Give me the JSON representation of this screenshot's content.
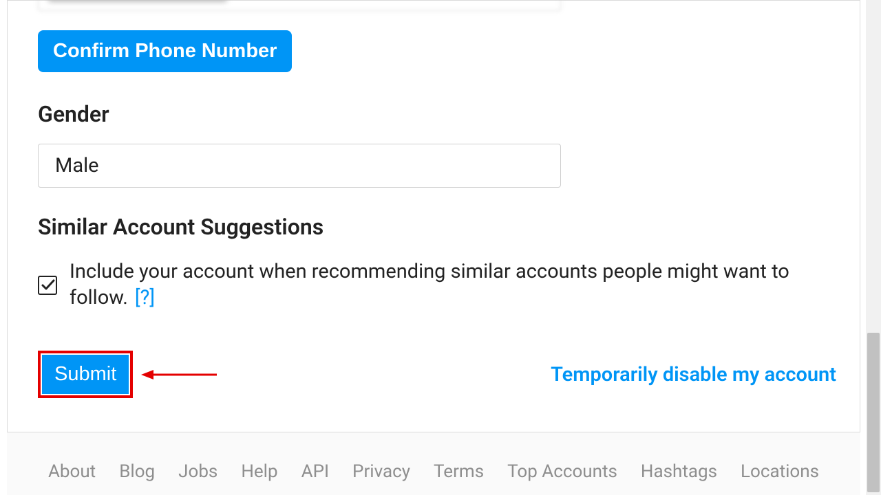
{
  "form": {
    "confirm_phone_label": "Confirm Phone Number",
    "gender_label": "Gender",
    "gender_value": "Male",
    "suggestions_label": "Similar Account Suggestions",
    "suggestions_text": "Include your account when recommending similar accounts people might want to follow.",
    "help_link_label": "[?]",
    "suggestions_checked": true,
    "submit_label": "Submit",
    "disable_label": "Temporarily disable my account"
  },
  "footer": {
    "links": [
      "About",
      "Blog",
      "Jobs",
      "Help",
      "API",
      "Privacy",
      "Terms",
      "Top Accounts",
      "Hashtags",
      "Locations"
    ]
  },
  "colors": {
    "accent": "#0095f6",
    "annotation": "#e40000"
  }
}
